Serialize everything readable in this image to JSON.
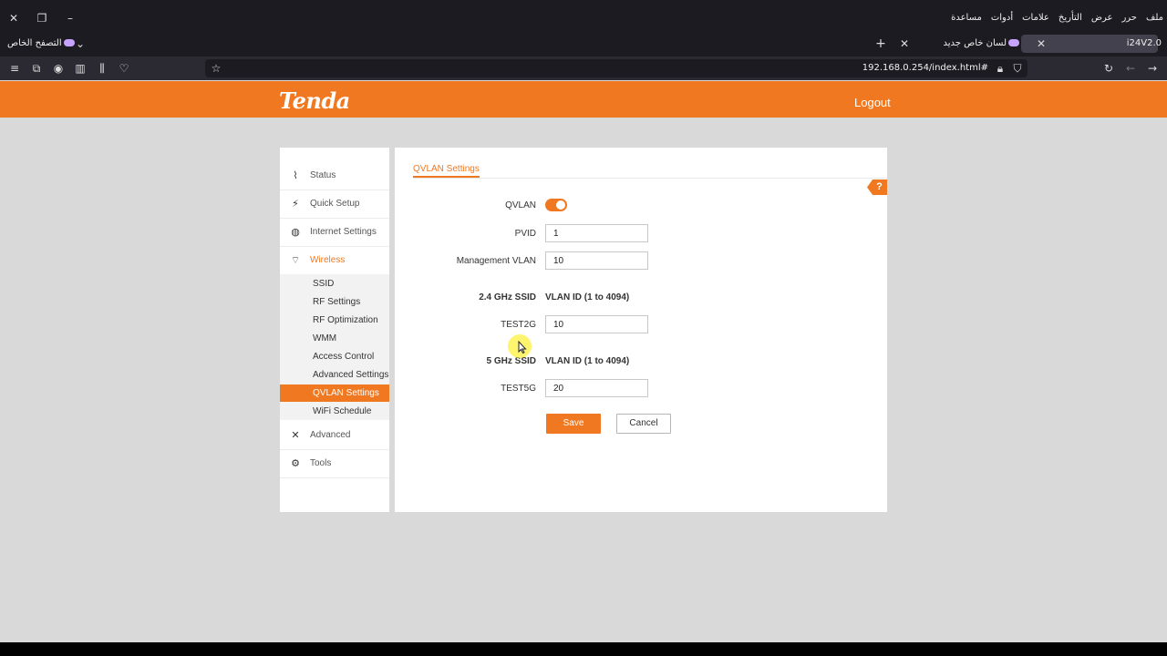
{
  "browser": {
    "menu": [
      "ملف",
      "حرر",
      "عرض",
      "التأريخ",
      "علامات",
      "أدوات",
      "مساعدة"
    ],
    "tabs": [
      {
        "title": "i24V2.0",
        "active": true
      },
      {
        "title": "لسان خاص جديد",
        "active": false
      }
    ],
    "private_label": "التصفح الخاص",
    "url": "192.168.0.254/index.html#"
  },
  "header": {
    "logo": "Tenda",
    "logout": "Logout"
  },
  "sidebar": {
    "items": [
      {
        "label": "Status",
        "icon": "pulse-icon"
      },
      {
        "label": "Quick Setup",
        "icon": "lightning-icon"
      },
      {
        "label": "Internet Settings",
        "icon": "globe-icon"
      },
      {
        "label": "Wireless",
        "icon": "wifi-icon",
        "active": true
      },
      {
        "label": "Advanced",
        "icon": "tools-icon"
      },
      {
        "label": "Tools",
        "icon": "gears-icon"
      }
    ],
    "wireless_sub": [
      "SSID",
      "RF Settings",
      "RF Optimization",
      "WMM",
      "Access Control",
      "Advanced Settings",
      "QVLAN Settings",
      "WiFi Schedule"
    ],
    "active_sub": "QVLAN Settings"
  },
  "main": {
    "title": "QVLAN Settings",
    "help": "?",
    "qvlan_label": "QVLAN",
    "qvlan_enabled": true,
    "pvid_label": "PVID",
    "pvid_value": "1",
    "mgmt_label": "Management VLAN",
    "mgmt_value": "10",
    "ssid24_header": "2.4 GHz SSID",
    "ssid5_header": "5 GHz SSID",
    "vlan_id_header": "VLAN ID (1 to 4094)",
    "ssid24_name": "TEST2G",
    "ssid24_value": "10",
    "ssid5_name": "TEST5G",
    "ssid5_value": "20",
    "save": "Save",
    "cancel": "Cancel"
  },
  "colors": {
    "accent": "#f07820",
    "page_bg": "#d9d9d9"
  }
}
